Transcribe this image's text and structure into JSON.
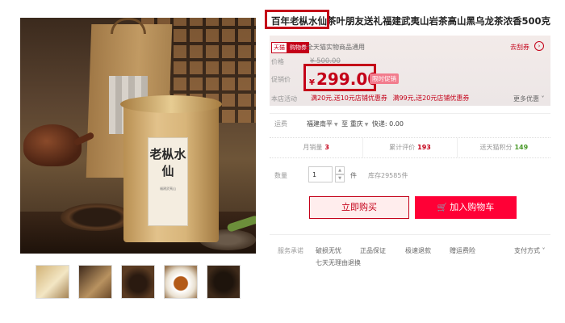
{
  "product": {
    "title": "百年老枞水仙茶叶朋友送礼福建武夷山岩茶高山黑乌龙茶浓香500克",
    "image_label_text": "老枞水仙",
    "image_label_small": "福建武夷山"
  },
  "badge": {
    "part1": "天猫",
    "part2": "购物券"
  },
  "coupon_note": "全天猫实物商品通用",
  "score_link": "去刮券",
  "labels": {
    "price": "价格",
    "promo_price": "促销价",
    "store_activity": "本店活动",
    "shipping": "运费",
    "quantity": "数量",
    "guarantee": "服务承诺",
    "pay": "支付方式"
  },
  "price": {
    "original": "¥ 500.00",
    "currency": "¥",
    "promo": "299.00",
    "promo_tag": "限时促销"
  },
  "store_coupons": [
    "满20元,送10元店铺优惠券",
    "满99元,送20元店铺优惠券"
  ],
  "more_offers": "更多优惠",
  "shipping": {
    "from": "福建南平",
    "to": "至 重庆",
    "method": "快递: 0.00"
  },
  "stats": [
    {
      "label": "月销量",
      "value": "3"
    },
    {
      "label": "累计评价",
      "value": "193"
    },
    {
      "label": "送天猫积分",
      "value": "149"
    }
  ],
  "quantity": {
    "value": "1",
    "unit": "件",
    "stock": "库存29585件"
  },
  "buttons": {
    "buy": "立即购买",
    "cart": "加入购物车"
  },
  "guarantees": [
    "破损无忧",
    "正品保证",
    "极速退款",
    "赠运费险"
  ],
  "return_policy": "七天无理由退换",
  "colors": {
    "accent": "#c40018",
    "cart": "#ff0036",
    "buy_bg": "#ffeded"
  }
}
